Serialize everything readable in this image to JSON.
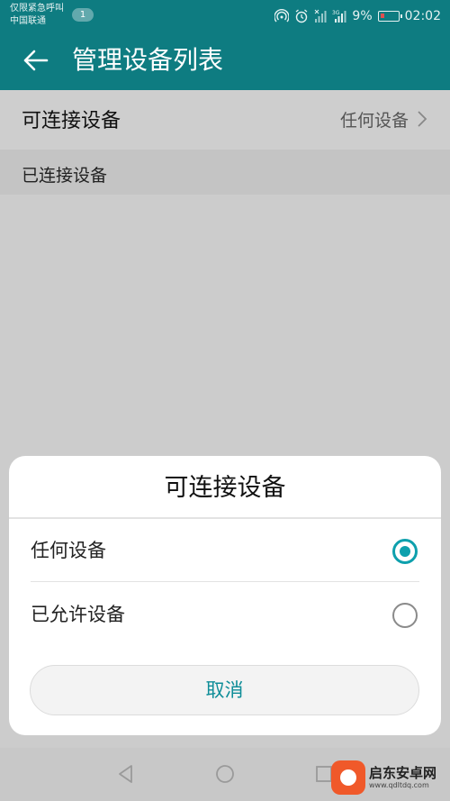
{
  "status_bar": {
    "carrier_line1": "仅限紧急呼叫",
    "carrier_line2": "中国联通",
    "notification_count": "1",
    "battery_percent": "9%",
    "time": "02:02",
    "icons": [
      "hotspot-icon",
      "alarm-icon",
      "signal-icon",
      "3g-signal-icon",
      "battery-icon"
    ]
  },
  "app_bar": {
    "back_icon": "back-arrow-icon",
    "title": "管理设备列表"
  },
  "list": {
    "connectable_label": "可连接设备",
    "connectable_value": "任何设备",
    "connected_section": "已连接设备"
  },
  "dialog": {
    "title": "可连接设备",
    "options": [
      {
        "label": "任何设备",
        "selected": true
      },
      {
        "label": "已允许设备",
        "selected": false
      }
    ],
    "cancel_label": "取消"
  },
  "watermark": {
    "name": "启东安卓网",
    "url": "www.qdltdq.com"
  },
  "colors": {
    "accent": "#0e7c81",
    "radio_accent": "#0ea0ad"
  }
}
